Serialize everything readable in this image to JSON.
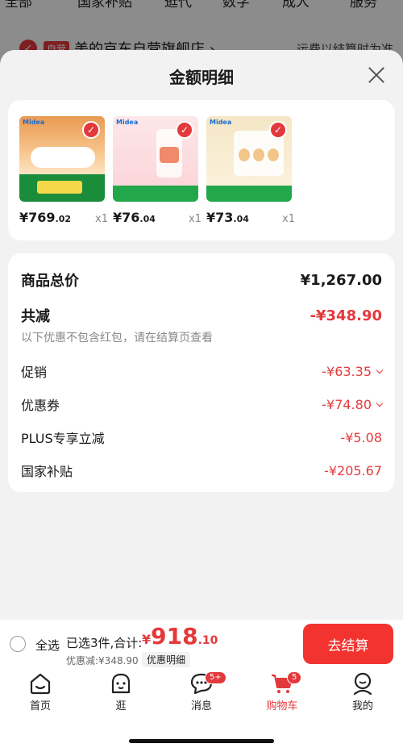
{
  "background_page": {
    "tabs": [
      "全部",
      "国家补贴",
      "逛代",
      "数字",
      "成人",
      "服务"
    ],
    "store_tag": "自营",
    "store_name": "美的京东自营旗舰店 ›",
    "shipping_note": "运费以结算时为准"
  },
  "sheet": {
    "title": "金额明细",
    "products": [
      {
        "price_main": "¥769",
        "price_dec": ".02",
        "qty": "x1",
        "brand": "Midea"
      },
      {
        "price_main": "¥76",
        "price_dec": ".04",
        "qty": "x1",
        "brand": "Midea"
      },
      {
        "price_main": "¥73",
        "price_dec": ".04",
        "qty": "x1",
        "brand": "Midea"
      }
    ],
    "summary": {
      "total_label": "商品总价",
      "total_value": "¥1,267.00",
      "reduce_label": "共减",
      "reduce_value": "-¥348.90",
      "note": "以下优惠不包含红包，请在结算页查看",
      "items": [
        {
          "label": "促销",
          "value": "-¥63.35",
          "expandable": true
        },
        {
          "label": "优惠券",
          "value": "-¥74.80",
          "expandable": true
        },
        {
          "label": "PLUS专享立减",
          "value": "-¥5.08",
          "expandable": false
        },
        {
          "label": "国家补贴",
          "value": "-¥205.67",
          "expandable": false
        }
      ]
    }
  },
  "bottom_bar": {
    "select_all": "全选",
    "selected_text": "已选3件,合计:",
    "total_symbol": "¥",
    "total_main": "918",
    "total_dec": ".10",
    "discount_text": "优惠减:¥348.90",
    "detail_button": "优惠明细",
    "checkout_button": "去结算"
  },
  "tab_bar": {
    "tabs": [
      {
        "label": "首页",
        "icon": "home-icon"
      },
      {
        "label": "逛",
        "icon": "face-icon"
      },
      {
        "label": "消息",
        "icon": "chat-icon",
        "badge": "5+"
      },
      {
        "label": "购物车",
        "icon": "cart-icon",
        "badge": "5",
        "active": true
      },
      {
        "label": "我的",
        "icon": "profile-icon"
      }
    ]
  },
  "colors": {
    "accent": "#e4393c",
    "checkout": "#f2332f"
  }
}
